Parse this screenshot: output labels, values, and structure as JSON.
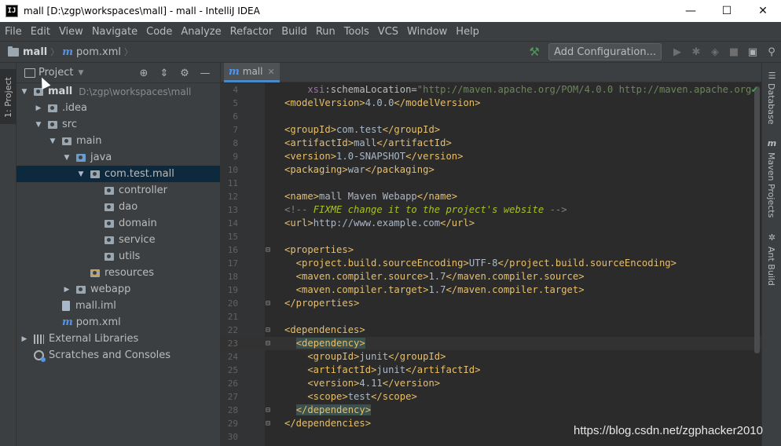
{
  "window": {
    "title": "mall [D:\\zgp\\workspaces\\mall] - mall - IntelliJ IDEA",
    "app_icon": "IJ",
    "minimize": "—",
    "maximize": "☐",
    "close": "✕"
  },
  "menu": [
    "File",
    "Edit",
    "View",
    "Navigate",
    "Code",
    "Analyze",
    "Refactor",
    "Build",
    "Run",
    "Tools",
    "VCS",
    "Window",
    "Help"
  ],
  "breadcrumb": {
    "project": "mall",
    "file": "pom.xml"
  },
  "toolbar": {
    "add_configuration": "Add Configuration..."
  },
  "left_strip": {
    "project_tab": "1: Project"
  },
  "project_panel": {
    "title": "Project",
    "tree": [
      {
        "label": "mall",
        "path": "D:\\zgp\\workspaces\\mall",
        "level": 0,
        "arrow": "▼",
        "icon": "folder-icon",
        "bold": true
      },
      {
        "label": ".idea",
        "level": 1,
        "arrow": "▶",
        "icon": "folder-icon"
      },
      {
        "label": "src",
        "level": 1,
        "arrow": "▼",
        "icon": "folder-icon"
      },
      {
        "label": "main",
        "level": 2,
        "arrow": "▼",
        "icon": "folder-icon"
      },
      {
        "label": "java",
        "level": 3,
        "arrow": "▼",
        "icon": "source-folder-icon"
      },
      {
        "label": "com.test.mall",
        "level": 4,
        "arrow": "▼",
        "icon": "package-icon",
        "selected": true
      },
      {
        "label": "controller",
        "level": 5,
        "arrow": "",
        "icon": "package-icon"
      },
      {
        "label": "dao",
        "level": 5,
        "arrow": "",
        "icon": "package-icon"
      },
      {
        "label": "domain",
        "level": 5,
        "arrow": "",
        "icon": "package-icon"
      },
      {
        "label": "service",
        "level": 5,
        "arrow": "",
        "icon": "package-icon"
      },
      {
        "label": "utils",
        "level": 5,
        "arrow": "",
        "icon": "package-icon"
      },
      {
        "label": "resources",
        "level": 4,
        "arrow": "",
        "icon": "resources-folder-icon"
      },
      {
        "label": "webapp",
        "level": 3,
        "arrow": "▶",
        "icon": "folder-icon"
      },
      {
        "label": "mall.iml",
        "level": 2,
        "arrow": "",
        "icon": "iml-file-icon"
      },
      {
        "label": "pom.xml",
        "level": 2,
        "arrow": "",
        "icon": "maven-file-icon"
      },
      {
        "label": "External Libraries",
        "level": 0,
        "arrow": "▶",
        "icon": "library-icon"
      },
      {
        "label": "Scratches and Consoles",
        "level": 0,
        "arrow": "",
        "icon": "scratches-icon"
      }
    ]
  },
  "editor": {
    "tab_label": "mall",
    "lines": [
      {
        "n": "4",
        "parts": [
          [
            "ns",
            "    xsi"
          ],
          [
            "attr",
            ":schemaLocation="
          ],
          [
            "val",
            "\"http://maven.apache.org/POM/4.0.0 http://maven.apache.org"
          ]
        ]
      },
      {
        "n": "5",
        "parts": [
          [
            "tag",
            "<modelVersion>"
          ],
          [
            "text",
            "4.0.0"
          ],
          [
            "tag",
            "</modelVersion>"
          ]
        ]
      },
      {
        "n": "6",
        "parts": []
      },
      {
        "n": "7",
        "parts": [
          [
            "tag",
            "<groupId>"
          ],
          [
            "text",
            "com.test"
          ],
          [
            "tag",
            "</groupId>"
          ]
        ]
      },
      {
        "n": "8",
        "parts": [
          [
            "tag",
            "<artifactId>"
          ],
          [
            "text",
            "mall"
          ],
          [
            "tag",
            "</artifactId>"
          ]
        ]
      },
      {
        "n": "9",
        "parts": [
          [
            "tag",
            "<version>"
          ],
          [
            "text",
            "1.0-SNAPSHOT"
          ],
          [
            "tag",
            "</version>"
          ]
        ]
      },
      {
        "n": "10",
        "parts": [
          [
            "tag",
            "<packaging>"
          ],
          [
            "text",
            "war"
          ],
          [
            "tag",
            "</packaging>"
          ]
        ]
      },
      {
        "n": "11",
        "parts": []
      },
      {
        "n": "12",
        "parts": [
          [
            "tag",
            "<name>"
          ],
          [
            "text",
            "mall Maven Webapp"
          ],
          [
            "tag",
            "</name>"
          ]
        ]
      },
      {
        "n": "13",
        "parts": [
          [
            "cmt",
            "<!-- "
          ],
          [
            "todo",
            "FIXME change it to the project's website"
          ],
          [
            "cmt",
            " -->"
          ]
        ]
      },
      {
        "n": "14",
        "parts": [
          [
            "tag",
            "<url>"
          ],
          [
            "text",
            "http://www.example.com"
          ],
          [
            "tag",
            "</url>"
          ]
        ]
      },
      {
        "n": "15",
        "parts": []
      },
      {
        "n": "16",
        "fold": "⊟",
        "parts": [
          [
            "tag",
            "<properties>"
          ]
        ]
      },
      {
        "n": "17",
        "parts": [
          [
            "tag",
            "  <project.build.sourceEncoding>"
          ],
          [
            "text",
            "UTF-8"
          ],
          [
            "tag",
            "</project.build.sourceEncoding>"
          ]
        ]
      },
      {
        "n": "18",
        "parts": [
          [
            "tag",
            "  <maven.compiler.source>"
          ],
          [
            "text",
            "1.7"
          ],
          [
            "tag",
            "</maven.compiler.source>"
          ]
        ]
      },
      {
        "n": "19",
        "parts": [
          [
            "tag",
            "  <maven.compiler.target>"
          ],
          [
            "text",
            "1.7"
          ],
          [
            "tag",
            "</maven.compiler.target>"
          ]
        ]
      },
      {
        "n": "20",
        "fold": "⊟",
        "parts": [
          [
            "tag",
            "</properties>"
          ]
        ]
      },
      {
        "n": "21",
        "parts": []
      },
      {
        "n": "22",
        "fold": "⊟",
        "parts": [
          [
            "tag",
            "<dependencies>"
          ]
        ]
      },
      {
        "n": "23",
        "fold": "⊟",
        "caret": true,
        "parts": [
          [
            "tag",
            "  "
          ],
          [
            "hl",
            "<dependency>"
          ]
        ]
      },
      {
        "n": "24",
        "parts": [
          [
            "tag",
            "    <groupId>"
          ],
          [
            "text",
            "junit"
          ],
          [
            "tag",
            "</groupId>"
          ]
        ]
      },
      {
        "n": "25",
        "parts": [
          [
            "tag",
            "    <artifactId>"
          ],
          [
            "text",
            "junit"
          ],
          [
            "tag",
            "</artifactId>"
          ]
        ]
      },
      {
        "n": "26",
        "parts": [
          [
            "tag",
            "    <version>"
          ],
          [
            "text",
            "4.11"
          ],
          [
            "tag",
            "</version>"
          ]
        ]
      },
      {
        "n": "27",
        "parts": [
          [
            "tag",
            "    <scope>"
          ],
          [
            "text",
            "test"
          ],
          [
            "tag",
            "</scope>"
          ]
        ]
      },
      {
        "n": "28",
        "fold": "⊟",
        "parts": [
          [
            "tag",
            "  "
          ],
          [
            "hl",
            "</dependency>"
          ]
        ]
      },
      {
        "n": "29",
        "fold": "⊟",
        "parts": [
          [
            "tag",
            "</dependencies>"
          ]
        ]
      },
      {
        "n": "30",
        "parts": []
      }
    ]
  },
  "right_strip": {
    "tabs": [
      "Database",
      "Maven Projects",
      "Ant Build"
    ]
  },
  "watermark": "https://blog.csdn.net/zgphacker2010",
  "colors": {
    "background": "#2b2b2b",
    "panel": "#3c3f41",
    "selection": "#0d293e",
    "tag": "#e8bf6a",
    "string": "#6a8759",
    "accent": "#4a88c7"
  }
}
